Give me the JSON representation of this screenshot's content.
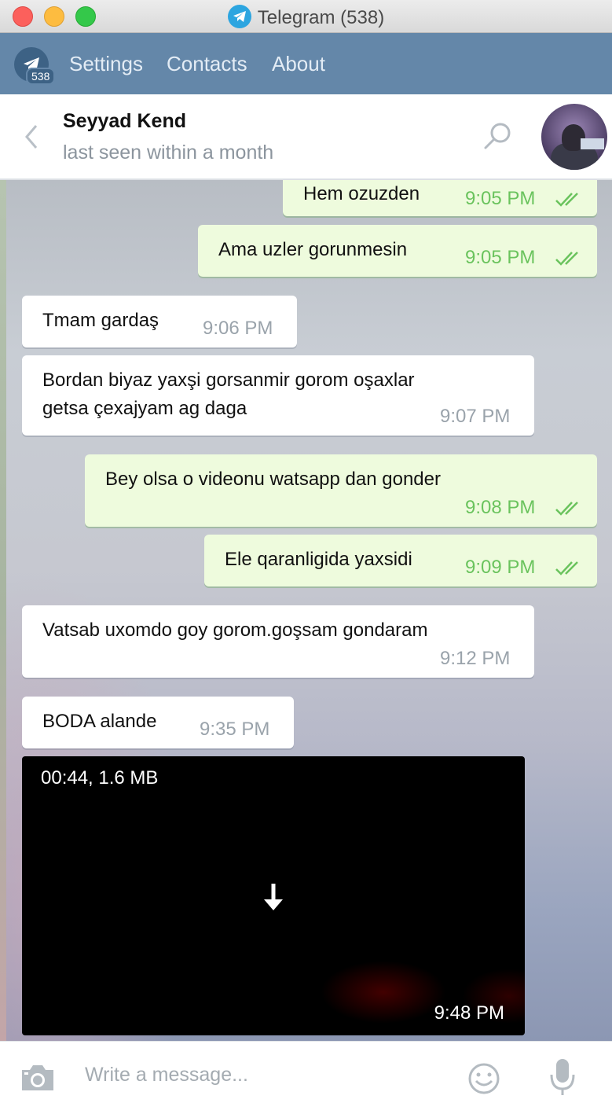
{
  "window": {
    "title": "Telegram (538)"
  },
  "nav": {
    "badge": "538",
    "links": [
      "Settings",
      "Contacts",
      "About"
    ]
  },
  "chat": {
    "peer_name": "Seyyad Kend",
    "peer_status": "last seen within a month"
  },
  "messages": [
    {
      "dir": "out",
      "text": "Hem ozuzden",
      "time": "9:05 PM",
      "status": "read"
    },
    {
      "dir": "out",
      "text": "Ama uzler gorunmesin",
      "time": "9:05 PM",
      "status": "read"
    },
    {
      "dir": "in",
      "text": "Tmam gardaş",
      "time": "9:06 PM"
    },
    {
      "dir": "in",
      "text_lines": [
        "Bordan biyaz yaxşi gorsanmir gorom oşaxlar",
        "getsa çexajyam ag daga"
      ],
      "time": "9:07 PM"
    },
    {
      "dir": "out",
      "text": "Bey olsa o videonu watsapp dan gonder",
      "time": "9:08 PM",
      "status": "read"
    },
    {
      "dir": "out",
      "text": "Ele qaranligida yaxsidi",
      "time": "9:09 PM",
      "status": "read"
    },
    {
      "dir": "in",
      "text": "Vatsab uxomdo goy gorom.goşsam gondaram",
      "time": "9:12 PM"
    },
    {
      "dir": "in",
      "text": "BODA alande",
      "time": "9:35 PM"
    }
  ],
  "video": {
    "info": "00:44, 1.6 MB",
    "time": "9:48 PM"
  },
  "composer": {
    "placeholder": "Write a message..."
  },
  "colors": {
    "nav_bg": "#6487a9",
    "out_bubble": "#eefbdd",
    "out_time": "#6ac35d",
    "in_time": "#9aa3ab"
  },
  "icons": [
    "telegram-icon",
    "back-chevron-icon",
    "search-icon",
    "camera-icon",
    "emoji-icon",
    "microphone-icon",
    "download-arrow-icon",
    "double-check-icon"
  ]
}
